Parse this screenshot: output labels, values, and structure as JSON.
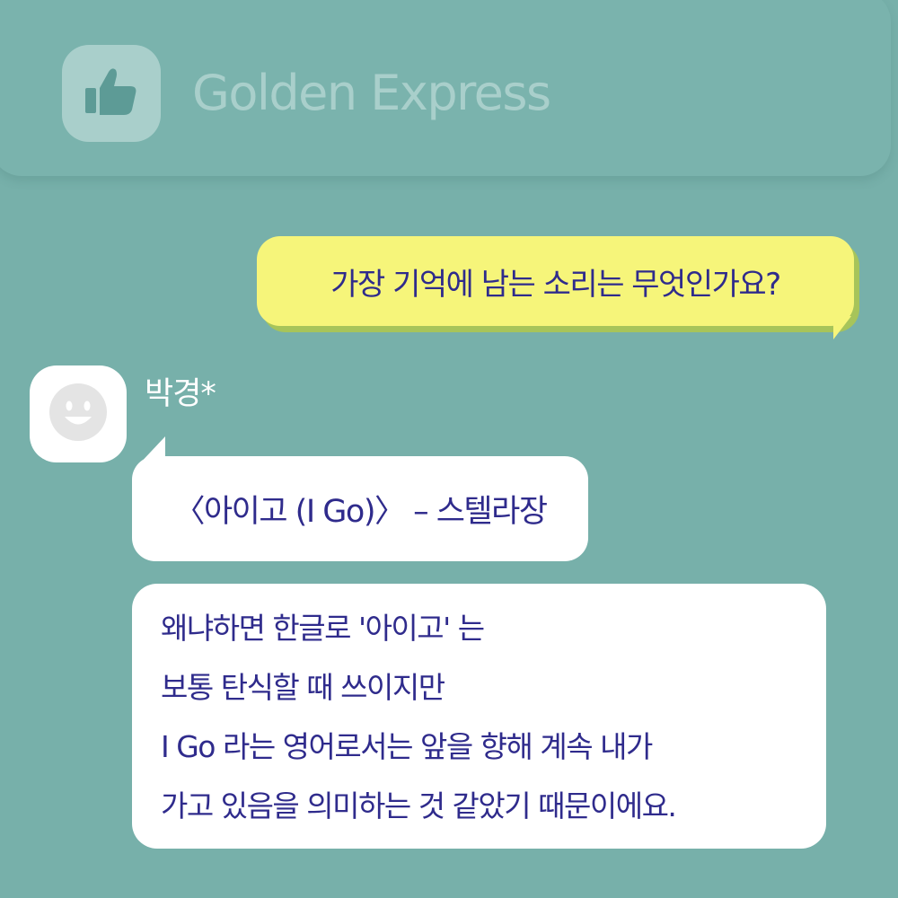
{
  "header": {
    "title": "Golden Express",
    "icon": "thumbs-up-icon"
  },
  "question": {
    "text": "가장 기억에 남는 소리는 무엇인가요?"
  },
  "reply": {
    "sender": "박경*",
    "avatar_icon": "smiley-face-icon",
    "song": "〈아이고 (I Go)〉 – 스텔라장",
    "answer_lines": [
      "왜냐하면 한글로 '아이고' 는",
      "보통 탄식할 때 쓰이지만",
      "I Go 라는 영어로서는 앞을 향해 계속 내가",
      "가고 있음을 의미하는 것 같았기 때문이에요."
    ]
  },
  "colors": {
    "background": "#77b0aa",
    "question_bubble": "#f6f57a",
    "text": "#2f2b8c",
    "icon_tile": "#a9cfcb"
  }
}
